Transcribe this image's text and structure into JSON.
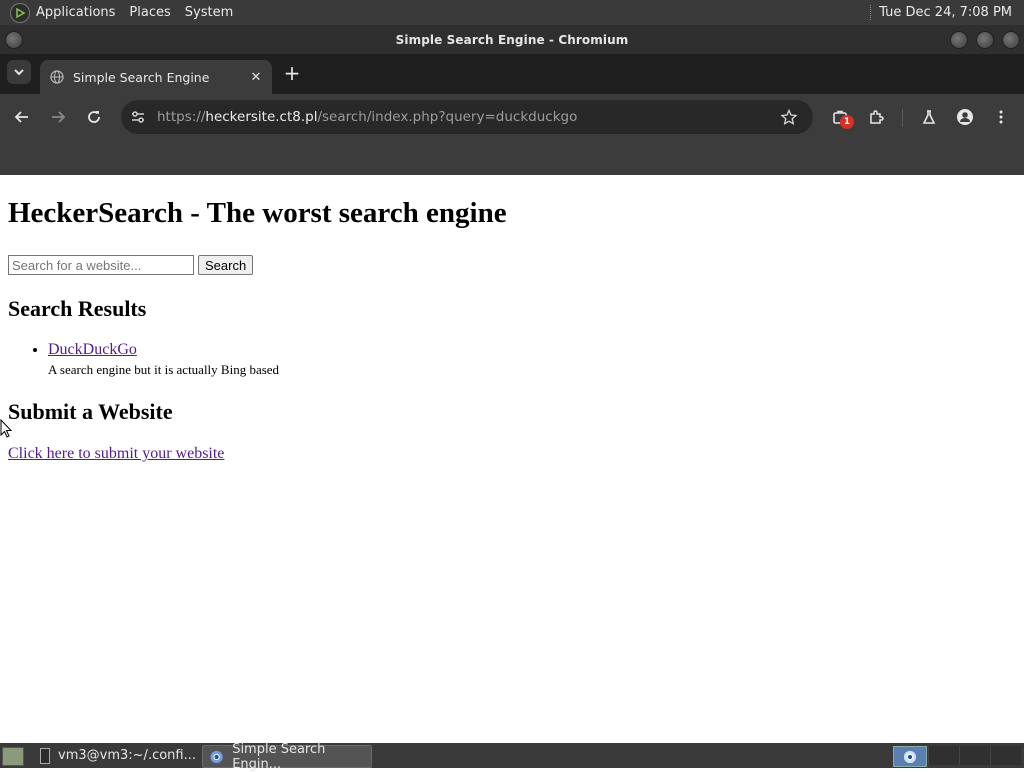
{
  "top_panel": {
    "menus": [
      "Applications",
      "Places",
      "System"
    ],
    "clock": "Tue Dec 24,  7:08 PM"
  },
  "window": {
    "title": "Simple Search Engine - Chromium"
  },
  "tabs": [
    {
      "label": "Simple Search Engine",
      "icon": "globe-icon",
      "active": true
    }
  ],
  "toolbar": {
    "url_scheme": "https://",
    "url_host": "heckersite.ct8.pl",
    "url_path": "/search/index.php?query=duckduckgo",
    "extensions_badge": "1"
  },
  "page": {
    "heading": "HeckerSearch - The worst search engine",
    "search": {
      "placeholder": "Search for a website...",
      "value": "",
      "button_label": "Search"
    },
    "results_heading": "Search Results",
    "results": [
      {
        "title": "DuckDuckGo",
        "description": "A search engine but it is actually Bing based"
      }
    ],
    "submit_heading": "Submit a Website",
    "submit_link": "Click here to submit your website"
  },
  "taskbar": {
    "tasks": [
      {
        "label": "vm3@vm3:~/.confi...",
        "icon": "terminal-icon",
        "active": false
      },
      {
        "label": "Simple Search Engin...",
        "icon": "chromium-icon",
        "active": true
      }
    ]
  },
  "colors": {
    "link_visited": "#551a8b",
    "tab_active": "#3c3c3c",
    "toolbar": "#3c3c3c",
    "badge": "#d93025"
  }
}
